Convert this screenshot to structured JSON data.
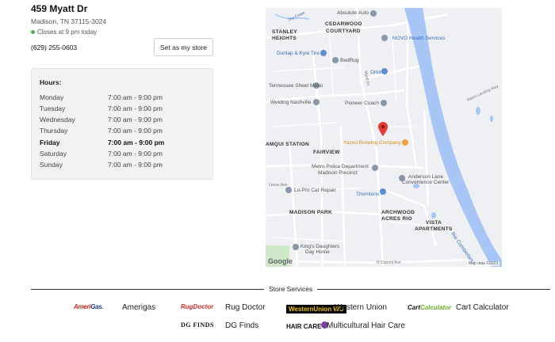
{
  "store": {
    "address": "459 Myatt Dr",
    "city": "Madison, TN 37115-3024",
    "status": "Closes at 9 pm today",
    "phone": "(629) 255-0603",
    "set_store_label": "Set as my store"
  },
  "hours": {
    "heading": "Hours:",
    "rows": [
      {
        "day": "Monday",
        "time": "7:00 am - 9:00 pm"
      },
      {
        "day": "Tuesday",
        "time": "7:00 am - 9:00 pm"
      },
      {
        "day": "Wednesday",
        "time": "7:00 am - 9:00 pm"
      },
      {
        "day": "Thursday",
        "time": "7:00 am - 9:00 pm"
      },
      {
        "day": "Friday",
        "time": "7:00 am - 9:00 pm"
      },
      {
        "day": "Saturday",
        "time": "7:00 am - 9:00 pm"
      },
      {
        "day": "Sunday",
        "time": "7:00 am - 9:00 pm"
      }
    ]
  },
  "map": {
    "labels": {
      "absolute_auto": "Absolute Auto",
      "dry_creek": "Dry Creek",
      "cedarwood": "CEDARWOOD",
      "courtyard": "COURTYARD",
      "stanley": "STANLEY",
      "heights": "HEIGHTS",
      "novo": "NOVO Health Services",
      "dunlap": "Dunlap & Kyle Tire",
      "bedrug": "BedRug",
      "orkin": "Orkin",
      "tennessee_sheet": "Tennessee Sheet Metal",
      "welding": "Welding Nashville",
      "pioneer": "Pioneer Coach",
      "yazoo": "Yazoo Brewing Company",
      "amqui": "AMQUI STATION",
      "fairview": "FAIRVIEW",
      "metro_police_1": "Metro Police Department",
      "metro_police_2": "Madison Precinct",
      "lopro": "Lo-Pro Car Repair",
      "thorntons": "Thorntons",
      "anderson_1": "Anderson Lane",
      "anderson_2": "Convenience Center",
      "madison_park": "MADISON PARK",
      "archwood_1": "ARCHWOOD",
      "archwood_2": "ACRES RIO",
      "vista_1": "VISTA",
      "vista_2": "APARTMENTS",
      "kings_1": "King's Daughters",
      "kings_2": "Day Home",
      "myatt_dr": "Myatt Dr",
      "river_road": "Rio Cumberland",
      "lenox": "Lenox Ave",
      "dupont": "N Dupont Ave",
      "warm_landing": "Warm Landing Way"
    },
    "google": "Google",
    "map_data": "Map data ©2023"
  },
  "services": {
    "title": "Store Services",
    "items": [
      {
        "logo_a": "Ameri",
        "logo_b": "Gas.",
        "name": "Amerigas"
      },
      {
        "logo": "RugDoctor",
        "name": "Rug Doctor"
      },
      {
        "logo": "WesternUnion WU",
        "name": "Western Union"
      },
      {
        "logo_a": "Cart",
        "logo_b": "Calculator",
        "name": "Cart Calculator"
      },
      {
        "logo": "DG FINDS",
        "name": "DG Finds"
      },
      {
        "logo": "HAIR CARE",
        "name": "Multicultural Hair Care"
      }
    ]
  },
  "colors": {
    "river": "#a8c6f5",
    "pin": "#e53935",
    "status_dot": "#4caf50"
  }
}
